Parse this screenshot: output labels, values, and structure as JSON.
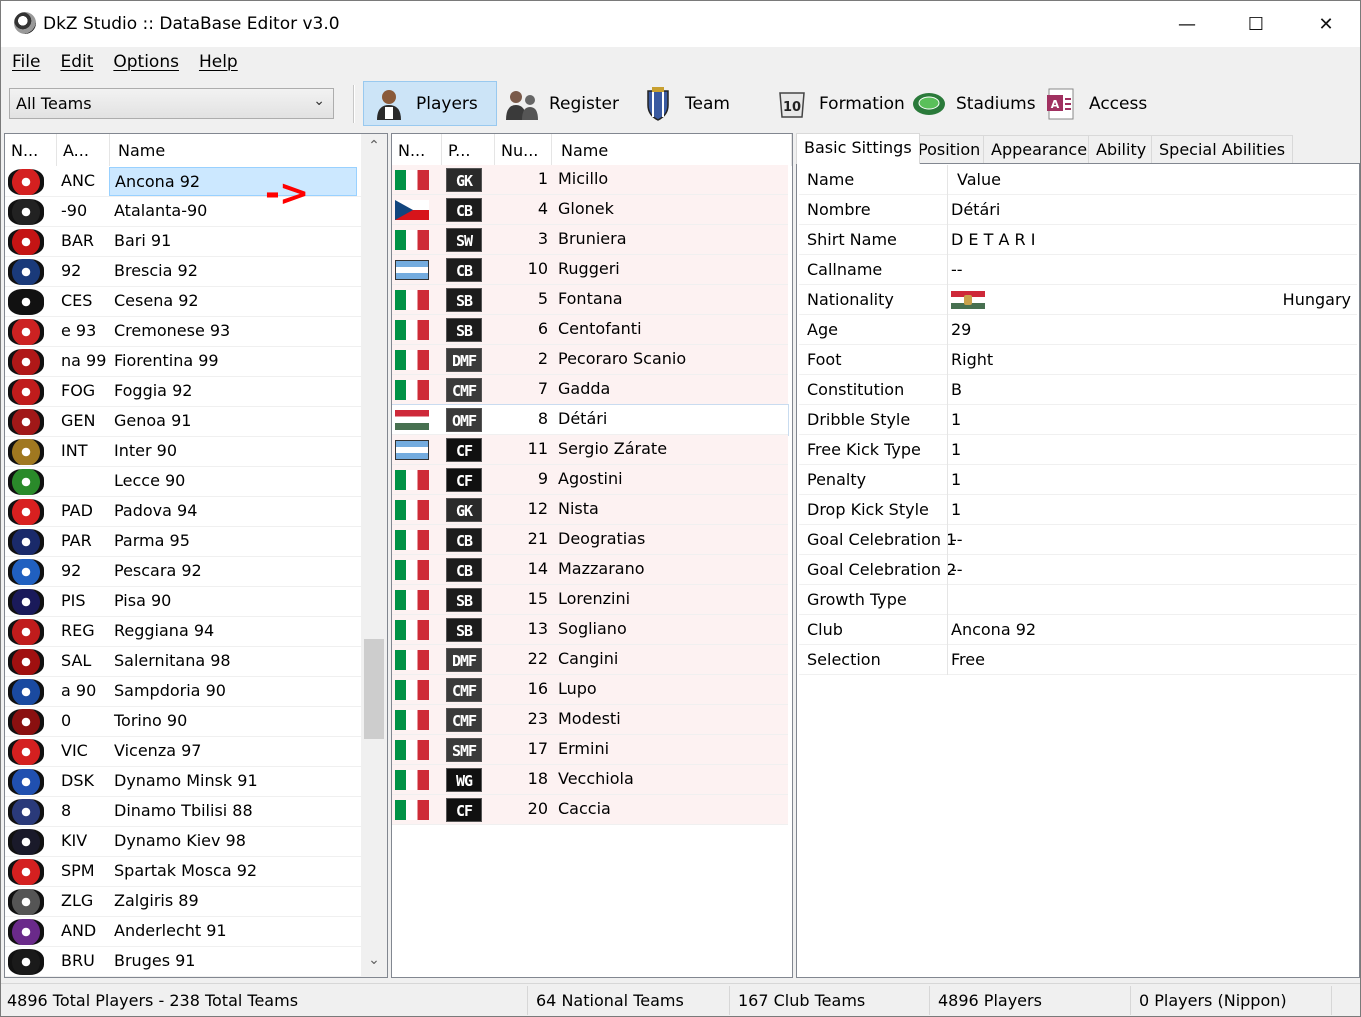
{
  "window": {
    "title": "DkZ Studio :: DataBase Editor v3.0",
    "minimize": "—",
    "maximize": "☐",
    "close": "✕"
  },
  "menu": [
    "File",
    "Edit",
    "Options",
    "Help"
  ],
  "toolbar": {
    "team_filter": "All Teams",
    "buttons": [
      {
        "label": "Players",
        "icon": "player-icon",
        "active": true
      },
      {
        "label": "Register",
        "icon": "register-icon"
      },
      {
        "label": "Team",
        "icon": "team-icon"
      },
      {
        "label": "Formation",
        "icon": "formation-icon"
      },
      {
        "label": "Stadiums",
        "icon": "stadium-icon"
      },
      {
        "label": "Access",
        "icon": "access-icon"
      }
    ]
  },
  "teams": {
    "headers": [
      "N...",
      "A...",
      "Name"
    ],
    "rows": [
      {
        "abbr": "ANC",
        "name": "Ancona 92",
        "color": "#d42020",
        "selected": true
      },
      {
        "abbr": "-90",
        "name": "Atalanta-90",
        "color": "#222222"
      },
      {
        "abbr": "BAR",
        "name": "Bari 91",
        "color": "#c41414"
      },
      {
        "abbr": "92",
        "name": "Brescia 92",
        "color": "#1a3a7a"
      },
      {
        "abbr": "CES",
        "name": "Cesena 92",
        "color": "#111111"
      },
      {
        "abbr": "e 93",
        "name": "Cremonese 93",
        "color": "#cc2222"
      },
      {
        "abbr": "na 99",
        "name": "Fiorentina 99",
        "color": "#b01818"
      },
      {
        "abbr": "FOG",
        "name": "Foggia 92",
        "color": "#c01c1c"
      },
      {
        "abbr": "GEN",
        "name": "Genoa 91",
        "color": "#a11818"
      },
      {
        "abbr": "INT",
        "name": "Inter 90",
        "color": "#a07820"
      },
      {
        "abbr": "",
        "name": "Lecce 90",
        "color": "#2a8a2a"
      },
      {
        "abbr": "PAD",
        "name": "Padova 94",
        "color": "#d82020"
      },
      {
        "abbr": "PAR",
        "name": "Parma 95",
        "color": "#1a2a6a"
      },
      {
        "abbr": "92",
        "name": "Pescara 92",
        "color": "#2060c0"
      },
      {
        "abbr": "PIS",
        "name": "Pisa 90",
        "color": "#1a1a5a"
      },
      {
        "abbr": "REG",
        "name": "Reggiana 94",
        "color": "#c01c1c"
      },
      {
        "abbr": "SAL",
        "name": "Salernitana 98",
        "color": "#a01010"
      },
      {
        "abbr": "a 90",
        "name": "Sampdoria 90",
        "color": "#1a4aa0"
      },
      {
        "abbr": "0",
        "name": "Torino 90",
        "color": "#8a1010"
      },
      {
        "abbr": "VIC",
        "name": "Vicenza 97",
        "color": "#d42020"
      },
      {
        "abbr": "DSK",
        "name": "Dynamo Minsk 91",
        "color": "#2050b0"
      },
      {
        "abbr": "8",
        "name": "Dinamo Tbilisi 88",
        "color": "#2a3a7a"
      },
      {
        "abbr": "KIV",
        "name": "Dynamo Kiev 98",
        "color": "#1a1a2a"
      },
      {
        "abbr": "SPM",
        "name": "Spartak Mosca 92",
        "color": "#d42020"
      },
      {
        "abbr": "ZLG",
        "name": "Zalgiris 89",
        "color": "#555555"
      },
      {
        "abbr": "AND",
        "name": "Anderlecht 91",
        "color": "#6a2a8a"
      },
      {
        "abbr": "BRU",
        "name": "Bruges 91",
        "color": "#1a1a1a"
      }
    ]
  },
  "annotation": "->",
  "players": {
    "headers": [
      "N...",
      "P...",
      "Nu...",
      "Name"
    ],
    "rows": [
      {
        "flag": "it",
        "pos": "GK",
        "num": "1",
        "name": "Micillo"
      },
      {
        "flag": "cz",
        "pos": "CB",
        "num": "4",
        "name": "Glonek"
      },
      {
        "flag": "it",
        "pos": "SW",
        "num": "3",
        "name": "Bruniera"
      },
      {
        "flag": "ar",
        "pos": "CB",
        "num": "10",
        "name": "Ruggeri"
      },
      {
        "flag": "it",
        "pos": "SB",
        "num": "5",
        "name": "Fontana"
      },
      {
        "flag": "it",
        "pos": "SB",
        "num": "6",
        "name": "Centofanti"
      },
      {
        "flag": "it",
        "pos": "DMF",
        "num": "2",
        "name": "Pecoraro Scanio"
      },
      {
        "flag": "it",
        "pos": "CMF",
        "num": "7",
        "name": "Gadda"
      },
      {
        "flag": "hu",
        "pos": "OMF",
        "num": "8",
        "name": "Détári",
        "highlight": true
      },
      {
        "flag": "ar",
        "pos": "CF",
        "num": "11",
        "name": "Sergio Zárate"
      },
      {
        "flag": "it",
        "pos": "CF",
        "num": "9",
        "name": "Agostini"
      },
      {
        "flag": "it",
        "pos": "GK",
        "num": "12",
        "name": "Nista"
      },
      {
        "flag": "it",
        "pos": "CB",
        "num": "21",
        "name": "Deogratias"
      },
      {
        "flag": "it",
        "pos": "CB",
        "num": "14",
        "name": "Mazzarano"
      },
      {
        "flag": "it",
        "pos": "SB",
        "num": "15",
        "name": "Lorenzini"
      },
      {
        "flag": "it",
        "pos": "SB",
        "num": "13",
        "name": "Sogliano"
      },
      {
        "flag": "it",
        "pos": "DMF",
        "num": "22",
        "name": "Cangini"
      },
      {
        "flag": "it",
        "pos": "CMF",
        "num": "16",
        "name": "Lupo"
      },
      {
        "flag": "it",
        "pos": "CMF",
        "num": "23",
        "name": "Modesti"
      },
      {
        "flag": "it",
        "pos": "SMF",
        "num": "17",
        "name": "Ermini"
      },
      {
        "flag": "it",
        "pos": "WG",
        "num": "18",
        "name": "Vecchiola"
      },
      {
        "flag": "it",
        "pos": "CF",
        "num": "20",
        "name": "Caccia"
      }
    ]
  },
  "details": {
    "tabs": [
      "Basic Sittings",
      "Position",
      "Appearance",
      "Ability",
      "Special Abilities"
    ],
    "header": {
      "key": "Name",
      "value": "Value"
    },
    "rows": [
      {
        "key": "Nombre",
        "value": "Détári"
      },
      {
        "key": "Shirt Name",
        "value": "D E T A R I"
      },
      {
        "key": "Callname",
        "value": "--"
      },
      {
        "key": "Nationality",
        "value": "Hungary",
        "flag": "hu"
      },
      {
        "key": "Age",
        "value": "29"
      },
      {
        "key": "Foot",
        "value": "Right"
      },
      {
        "key": "Constitution",
        "value": "B"
      },
      {
        "key": "Dribble Style",
        "value": "1"
      },
      {
        "key": "Free Kick Type",
        "value": "1"
      },
      {
        "key": "Penalty",
        "value": "1"
      },
      {
        "key": "Drop Kick Style",
        "value": "1"
      },
      {
        "key": "Goal Celebration 1",
        "value": "--"
      },
      {
        "key": "Goal Celebration 2",
        "value": "--"
      },
      {
        "key": "Growth Type",
        "value": ""
      },
      {
        "key": "Club",
        "value": "Ancona 92"
      },
      {
        "key": "Selection",
        "value": "Free"
      }
    ]
  },
  "status": {
    "totals": "4896 Total Players  -  238 Total Teams",
    "national": "64 National Teams",
    "club": "167 Club Teams",
    "players": "4896 Players",
    "nippon": "0 Players (Nippon)"
  }
}
